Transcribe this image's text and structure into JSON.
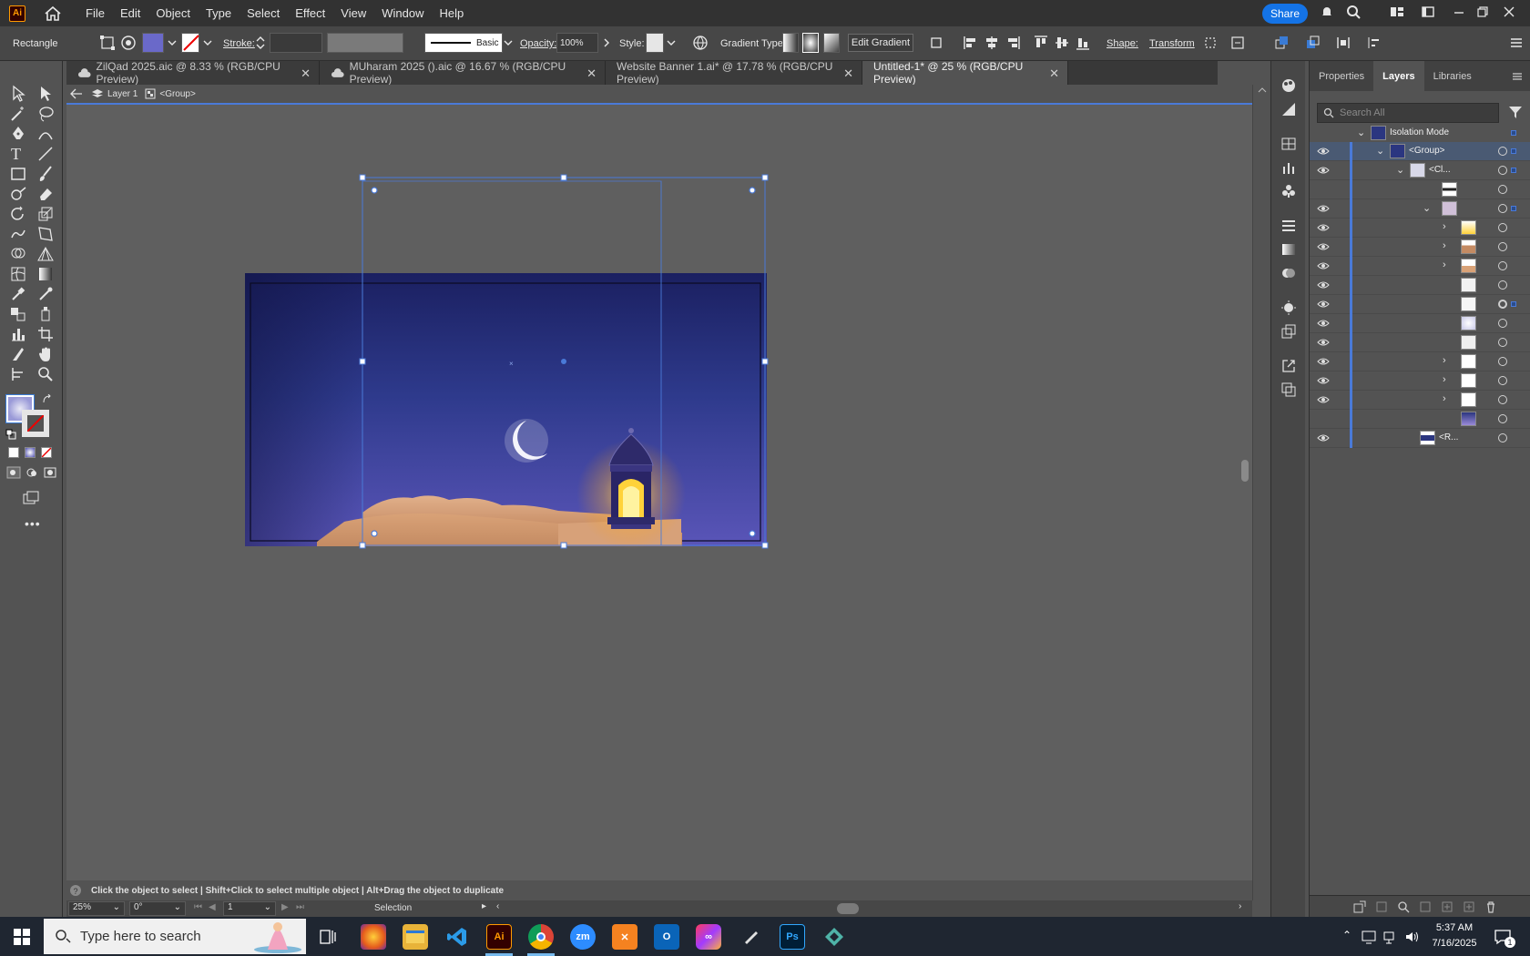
{
  "app": {
    "logo": "Ai"
  },
  "menu": [
    "File",
    "Edit",
    "Object",
    "Type",
    "Select",
    "Effect",
    "View",
    "Window",
    "Help"
  ],
  "header": {
    "share_label": "Share"
  },
  "control_bar": {
    "selection_label": "Rectangle",
    "stroke_label": "Stroke:",
    "brush_label": "Basic",
    "opacity_label": "Opacity:",
    "opacity_value": "100%",
    "style_label": "Style:",
    "gradient_type_label": "Gradient Type:",
    "edit_gradient_label": "Edit Gradient",
    "shape_label": "Shape:",
    "transform_label": "Transform"
  },
  "tabs": [
    {
      "label": "ZilQad 2025.aic @ 8.33 % (RGB/CPU Preview)",
      "active": false
    },
    {
      "label": "MUharam 2025 ().aic @ 16.67 % (RGB/CPU Preview)",
      "active": false
    },
    {
      "label": "Website Banner 1.ai* @ 17.78 % (RGB/CPU Preview)",
      "active": false
    },
    {
      "label": "Untitled-1* @ 25 % (RGB/CPU Preview)",
      "active": true
    }
  ],
  "breadcrumb": {
    "layer": "Layer 1",
    "group": "<Group>"
  },
  "status": {
    "hint": "Click the object to select  |  Shift+Click to select multiple object  |  Alt+Drag the object to duplicate",
    "zoom": "25%",
    "rotation": "0°",
    "artboard": "1",
    "tool": "Selection"
  },
  "layers_panel": {
    "tabs": [
      "Properties",
      "Layers",
      "Libraries"
    ],
    "active_tab": "Layers",
    "search_placeholder": "Search All",
    "isolation_label": "Isolation Mode",
    "group_label": "<Group>",
    "clip_label": "<Cl...",
    "rect_label": "<R..."
  },
  "taskbar": {
    "search_placeholder": "Type here to search",
    "time": "5:37 AM",
    "date": "7/16/2025",
    "notifications": "1"
  },
  "colors": {
    "accent": "#1473e6",
    "selection_blue": "#4a7ad8",
    "sky_top": "#1c2260",
    "sky_bottom": "#5a55b8",
    "sand": "#d9a277",
    "lantern_glow": "#ffd23a"
  }
}
